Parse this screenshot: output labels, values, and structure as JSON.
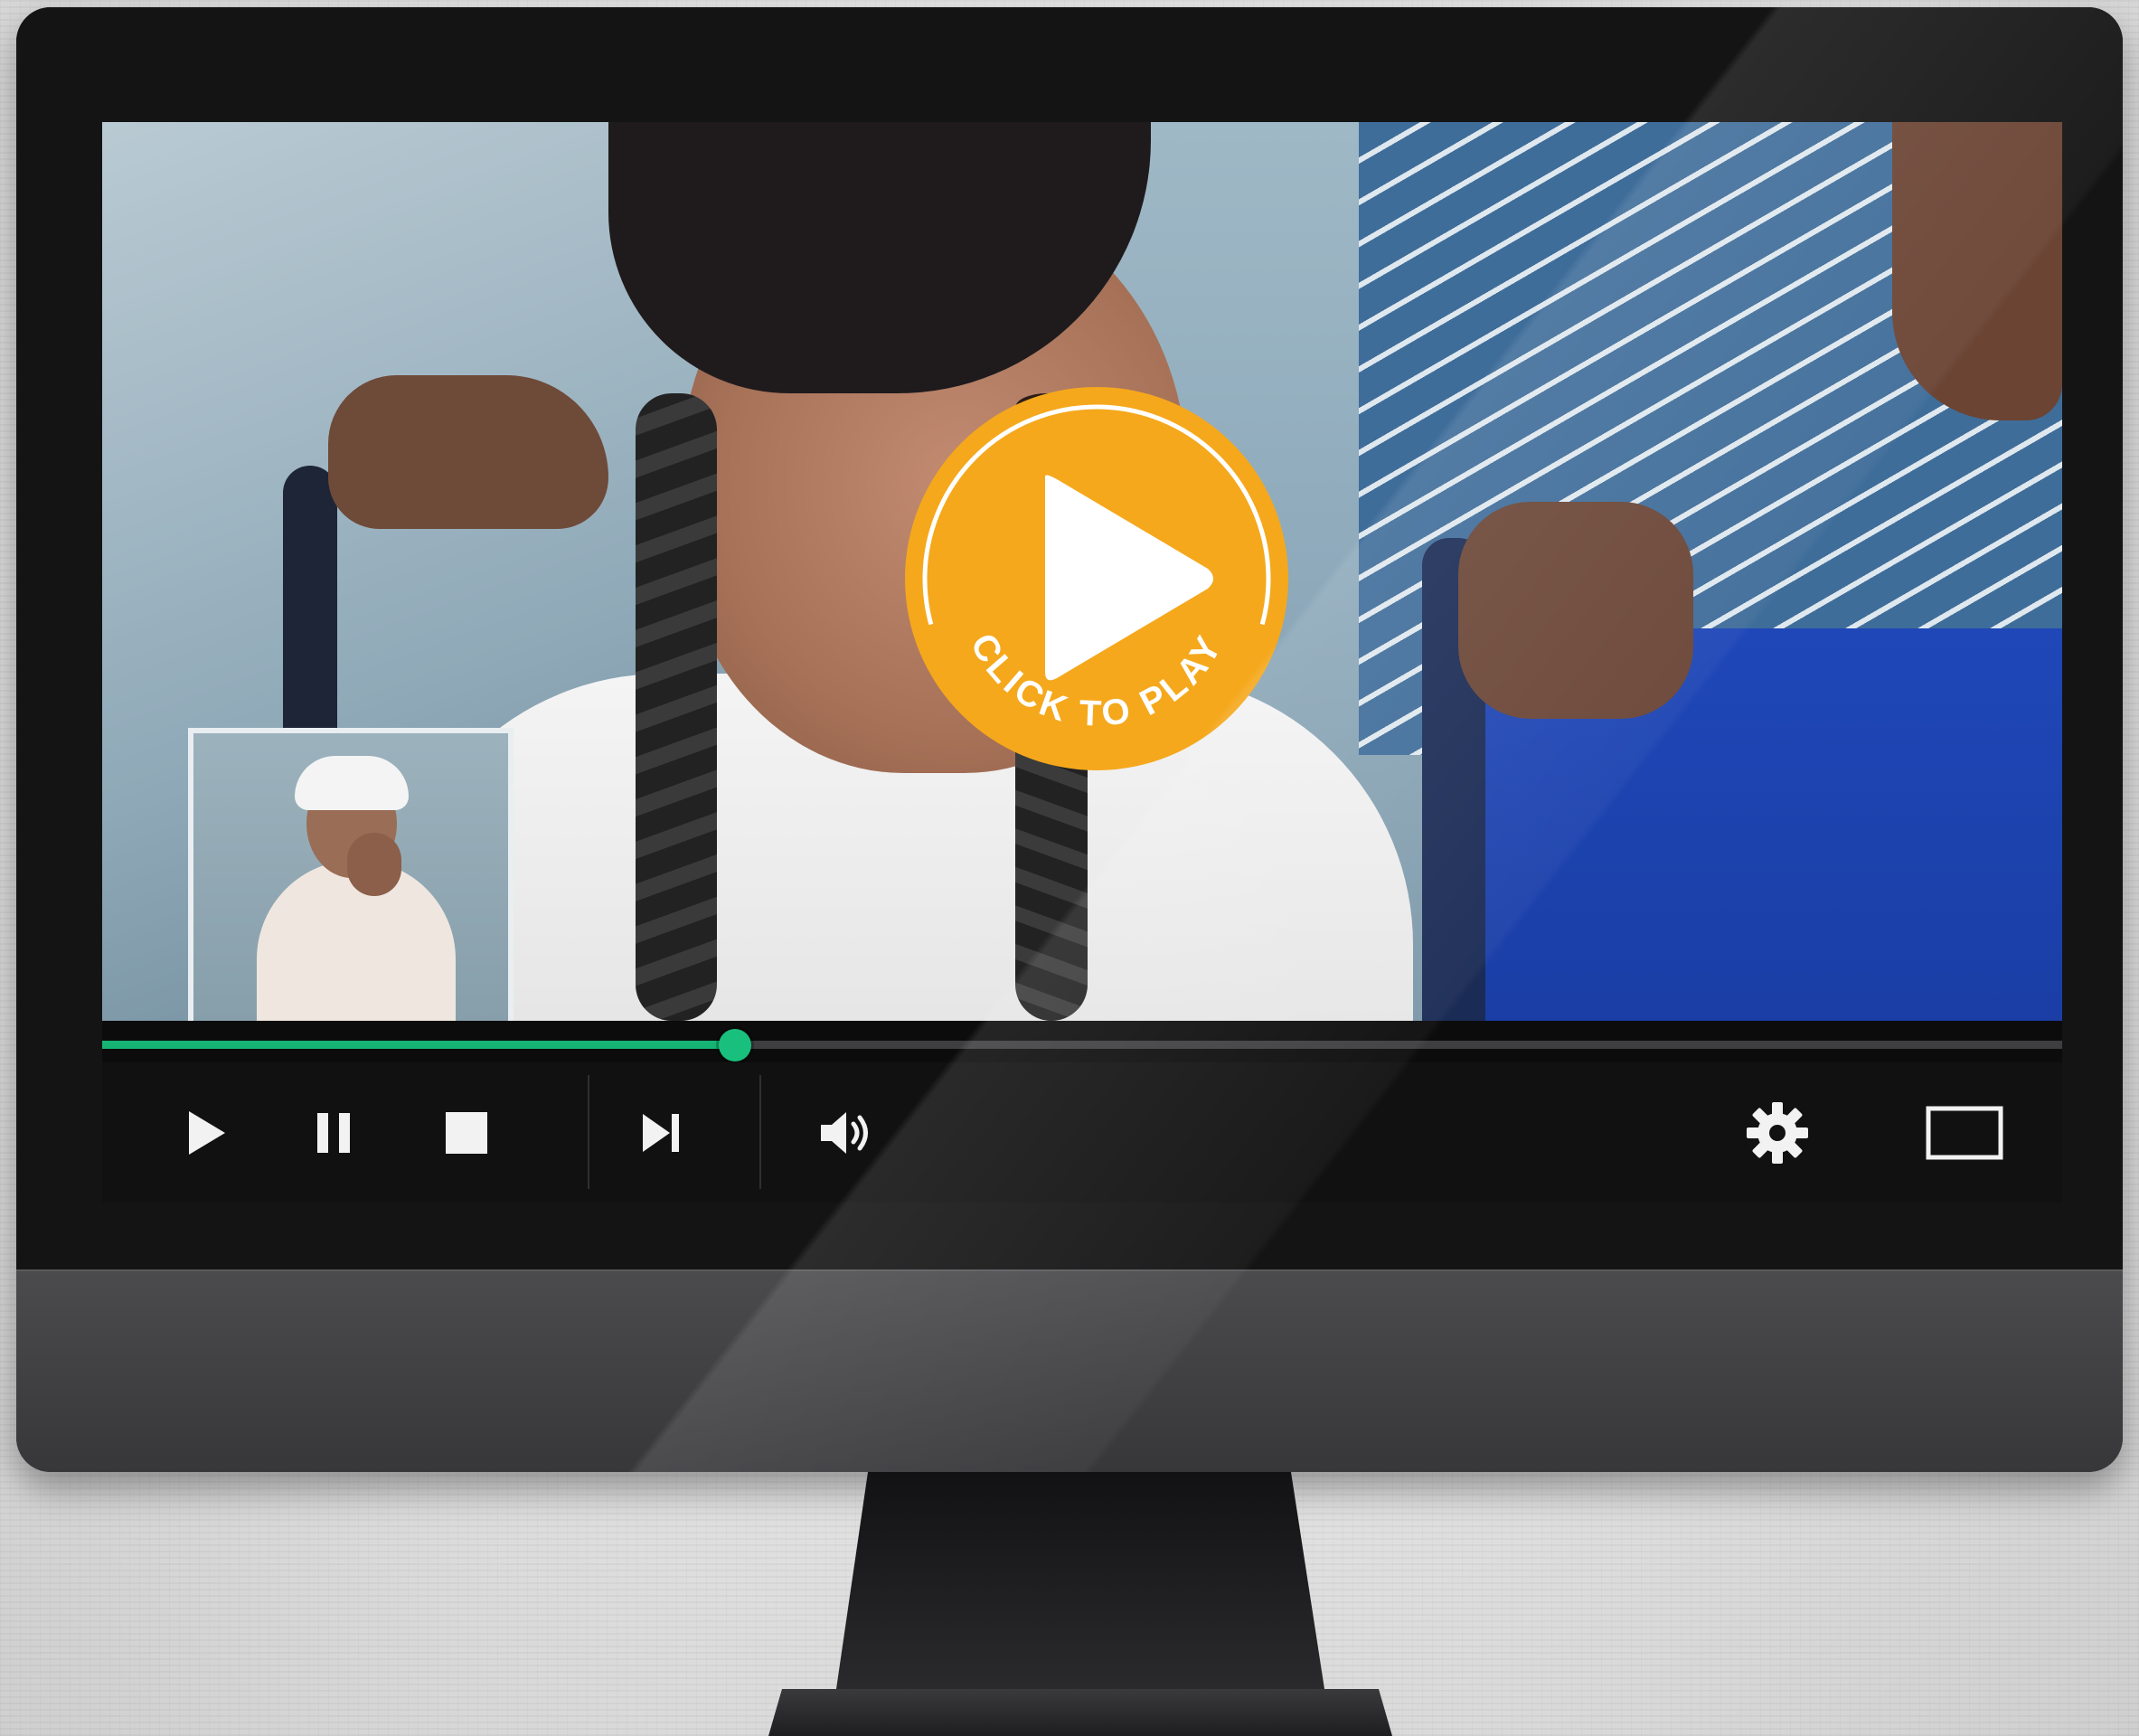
{
  "overlay": {
    "button_label": "CLICK TO PLAY",
    "icon": "play-icon",
    "color": "#f5a81c"
  },
  "player": {
    "progress": 0.323,
    "progress_color": "#16b474",
    "controls": [
      {
        "name": "play-button",
        "icon": "play-icon"
      },
      {
        "name": "pause-button",
        "icon": "pause-icon"
      },
      {
        "name": "stop-button",
        "icon": "stop-icon"
      },
      {
        "name": "skip-next-button",
        "icon": "skip-next-icon"
      },
      {
        "name": "volume-button",
        "icon": "volume-icon"
      },
      {
        "name": "settings-button",
        "icon": "gear-icon"
      },
      {
        "name": "fullscreen-button",
        "icon": "fullscreen-icon"
      }
    ]
  }
}
